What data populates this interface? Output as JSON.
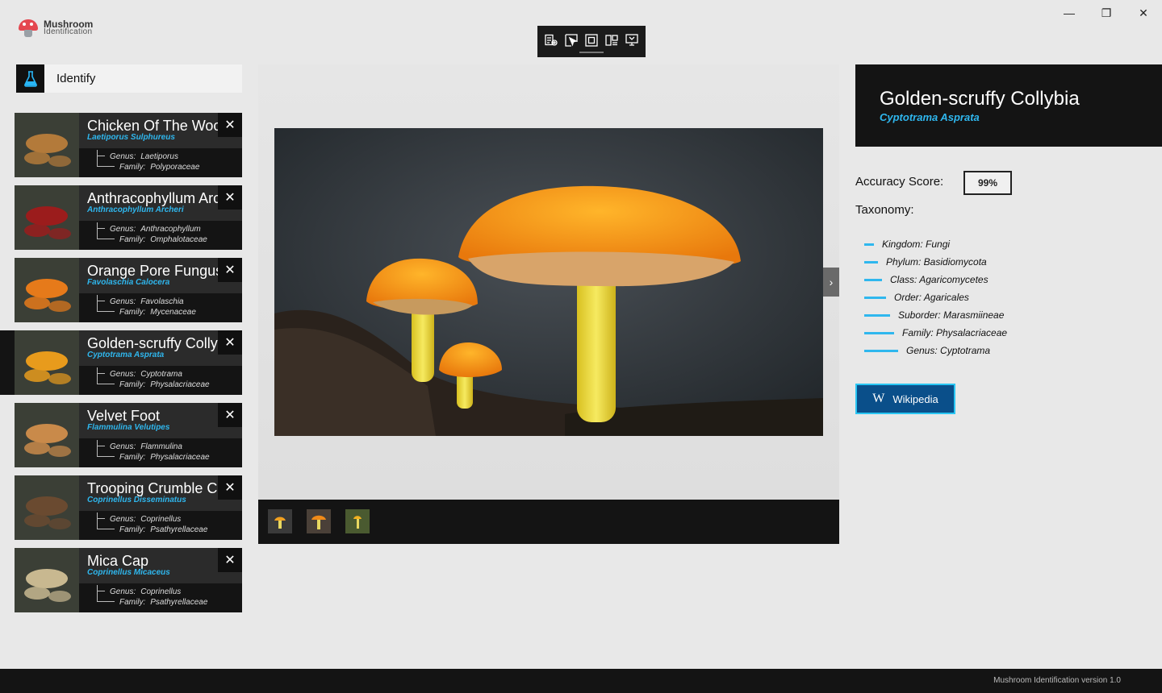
{
  "app": {
    "name_line1": "Mushroom",
    "name_line2": "Identification"
  },
  "window_controls": {
    "minimize": "—",
    "maximize": "❐",
    "close": "✕"
  },
  "sidebar": {
    "identify_label": "Identify",
    "items": [
      {
        "common": "Chicken Of The Woods",
        "scientific": "Laetiporus Sulphureus",
        "genus_label": "Genus:",
        "genus": "Laetiporus",
        "family_label": "Family:",
        "family": "Polyporaceae",
        "close": "✕",
        "thumb_color": "#b37a3a"
      },
      {
        "common": "Anthracophyllum Archeri",
        "scientific": "Anthracophyllum Archeri",
        "genus_label": "Genus:",
        "genus": "Anthracophyllum",
        "family_label": "Family:",
        "family": "Omphalotaceae",
        "close": "✕",
        "thumb_color": "#9b1c1c"
      },
      {
        "common": "Orange Pore Fungus",
        "scientific": "Favolaschia Calocera",
        "genus_label": "Genus:",
        "genus": "Favolaschia",
        "family_label": "Family:",
        "family": "Mycenaceae",
        "close": "✕",
        "thumb_color": "#e67a1a"
      },
      {
        "common": "Golden-scruffy Collybia",
        "scientific": "Cyptotrama Asprata",
        "genus_label": "Genus:",
        "genus": "Cyptotrama",
        "family_label": "Family:",
        "family": "Physalacriaceae",
        "close": "✕",
        "thumb_color": "#e89b1c"
      },
      {
        "common": "Velvet Foot",
        "scientific": "Flammulina Velutipes",
        "genus_label": "Genus:",
        "genus": "Flammulina",
        "family_label": "Family:",
        "family": "Physalacriaceae",
        "close": "✕",
        "thumb_color": "#c98a4a"
      },
      {
        "common": "Trooping Crumble Cap",
        "scientific": "Coprinellus Disseminatus",
        "genus_label": "Genus:",
        "genus": "Coprinellus",
        "family_label": "Family:",
        "family": "Psathyrellaceae",
        "close": "✕",
        "thumb_color": "#6a4a30"
      },
      {
        "common": "Mica Cap",
        "scientific": "Coprinellus Micaceus",
        "genus_label": "Genus:",
        "genus": "Coprinellus",
        "family_label": "Family:",
        "family": "Psathyrellaceae",
        "close": "✕",
        "thumb_color": "#c8b890"
      }
    ]
  },
  "viewer": {
    "next_label": "›"
  },
  "detail": {
    "common": "Golden-scruffy Collybia",
    "scientific": "Cyptotrama Asprata",
    "accuracy_label": "Accuracy Score:",
    "accuracy_value": "99%",
    "taxonomy_label": "Taxonomy:",
    "taxonomy": [
      "Kingdom: Fungi",
      "Phylum: Basidiomycota",
      "Class: Agaricomycetes",
      "Order: Agaricales",
      "Suborder: Marasmiineae",
      "Family: Physalacriaceae",
      "Genus: Cyptotrama"
    ],
    "wiki_icon": "W",
    "wiki_label": "Wikipedia"
  },
  "footer": {
    "version": "Mushroom Identification version 1.0"
  },
  "colors": {
    "accent": "#2fb7ee",
    "dark": "#141414",
    "wiki_bg": "#0a4f8a"
  }
}
